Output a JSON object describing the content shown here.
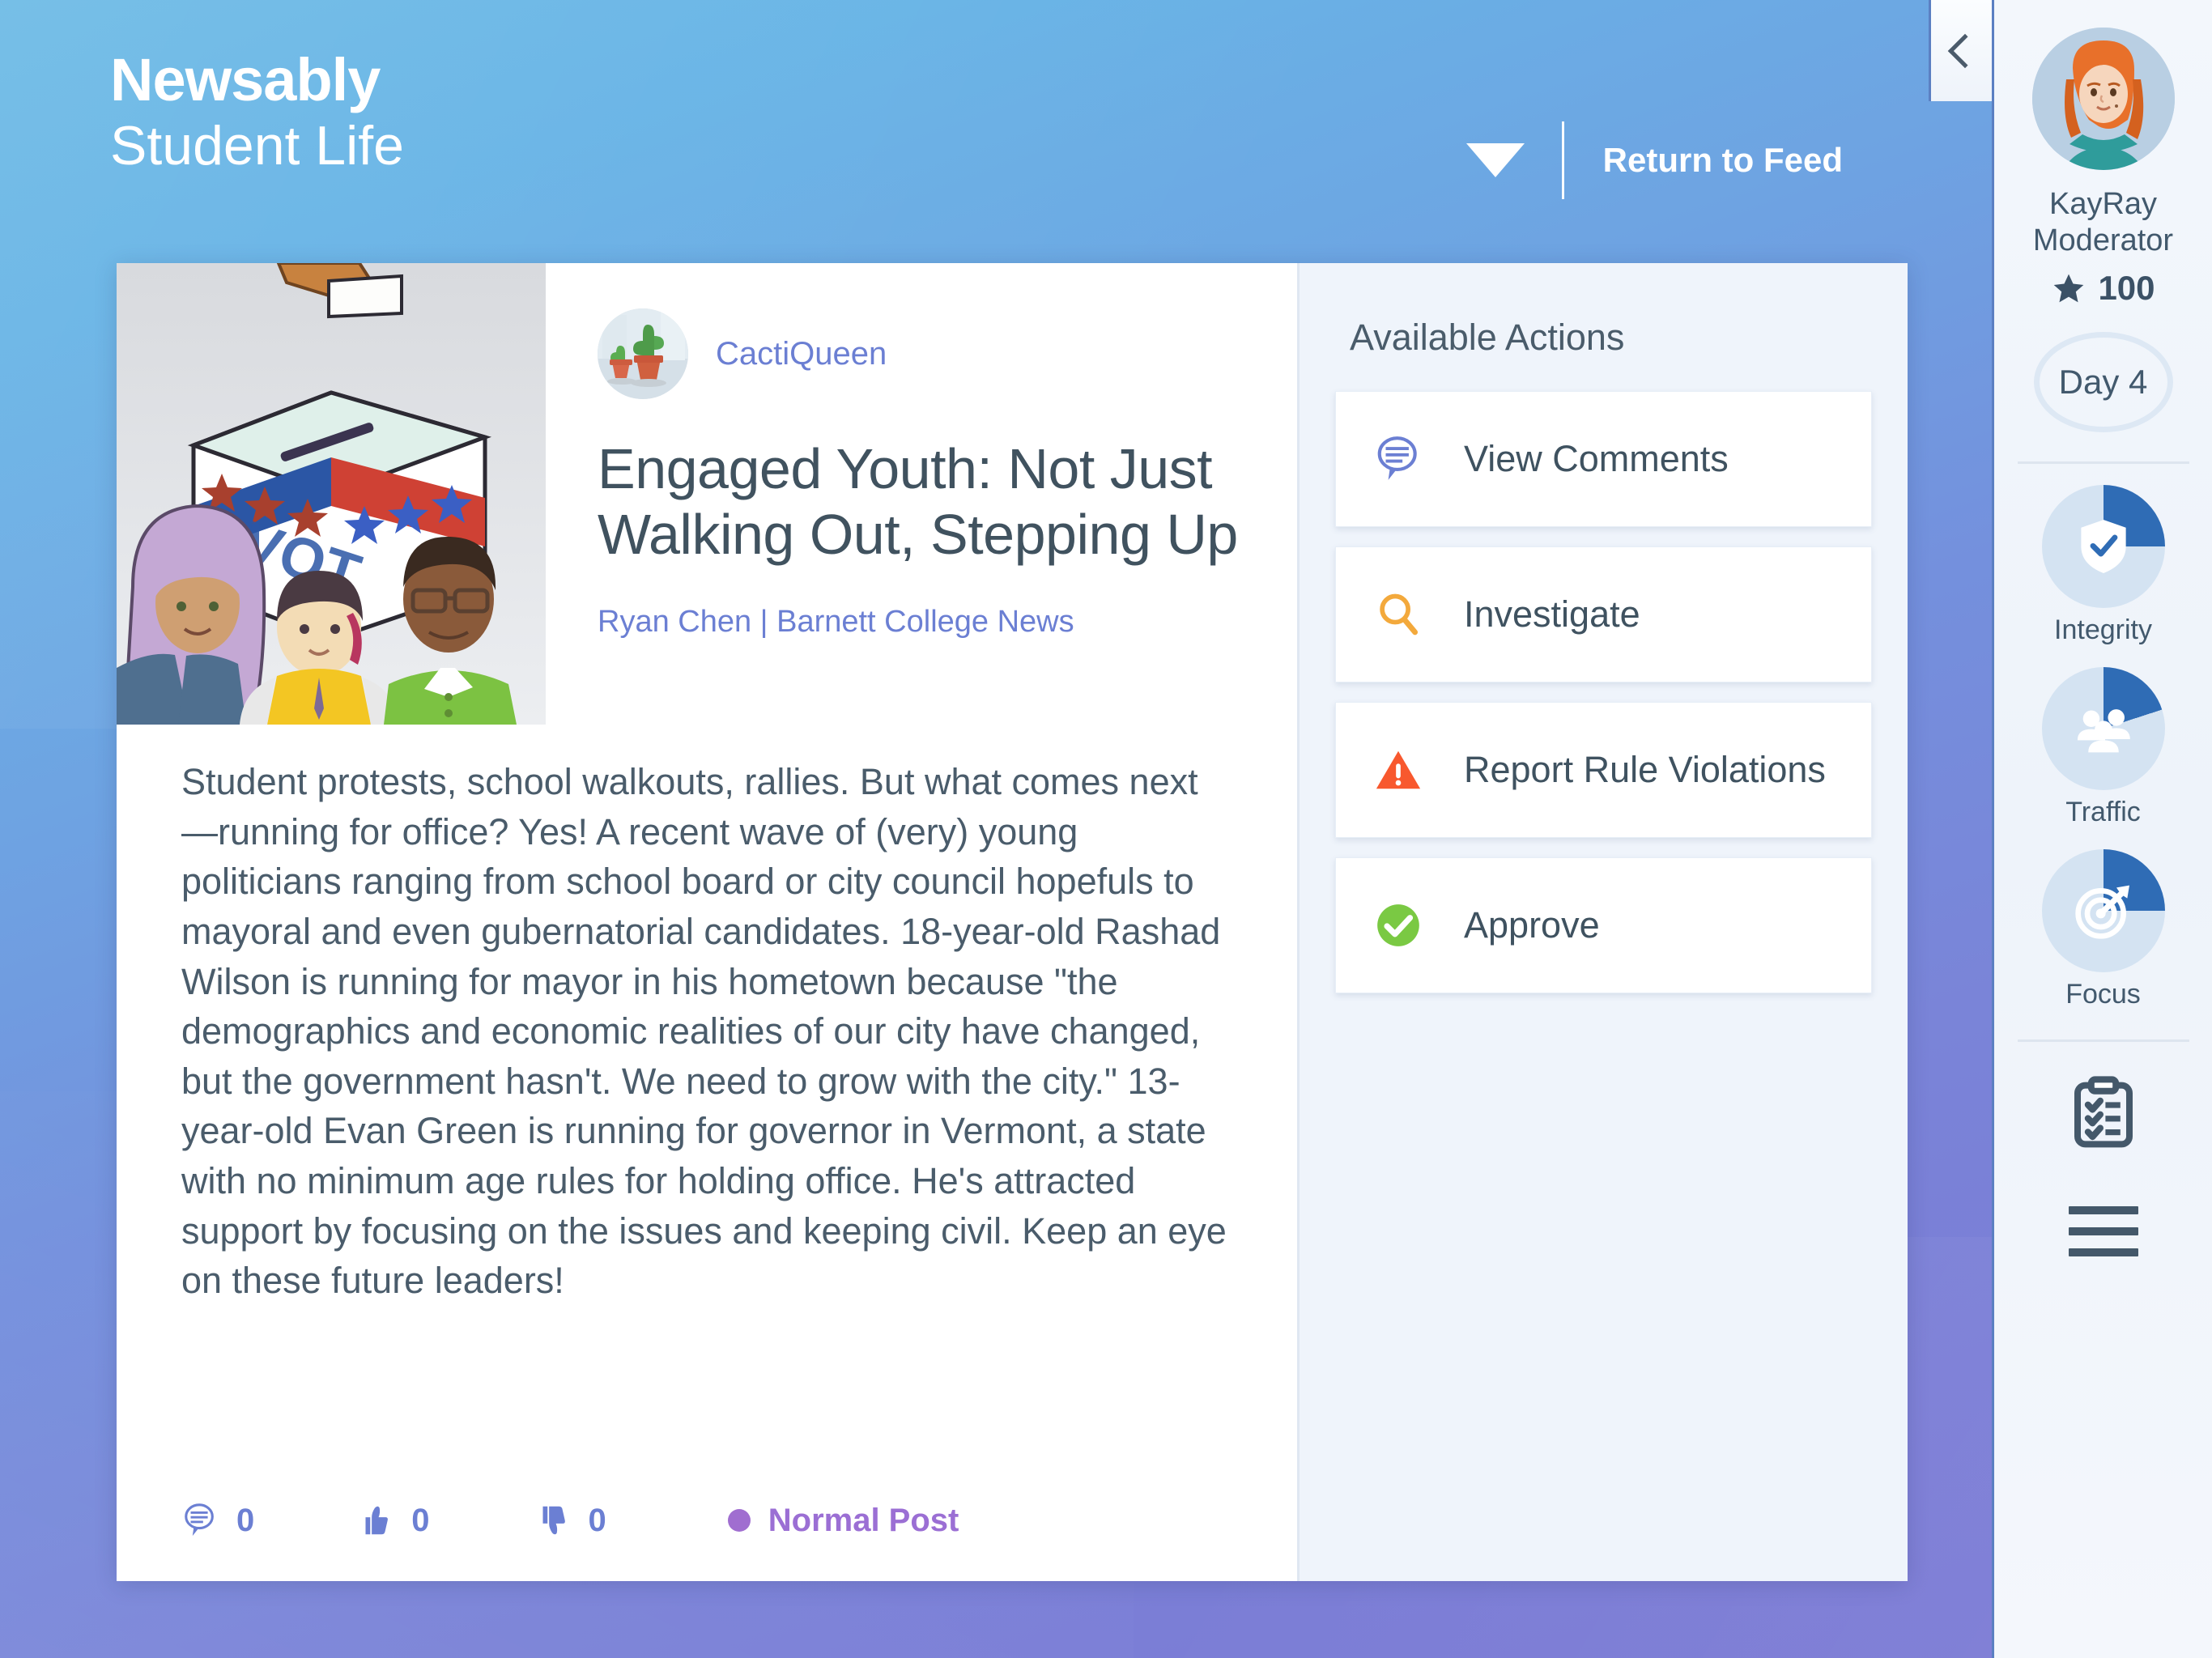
{
  "header": {
    "brand_title": "Newsably",
    "brand_subtitle": "Student Life",
    "return_label": "Return to Feed",
    "dropdown_icon": "caret-down-icon",
    "collapse_icon": "chevron-left-icon"
  },
  "article": {
    "author": "CactiQueen",
    "author_avatar_icon": "cacti-avatar",
    "thumbnail_icon": "vote-ballot-illustration",
    "title": "Engaged Youth: Not Just Walking Out, Stepping Up",
    "byline": "Ryan Chen | Barnett College News",
    "body": "Student protests, school walkouts, rallies. But what comes next—running for office? Yes! A recent wave of (very) young politicians ranging from school board or city council hopefuls to mayoral and even gubernatorial candidates. 18-year-old Rashad Wilson is running for mayor in his hometown because \"the demographics and economic realities of our city have changed, but the government hasn't. We need to grow with the city.\" 13-year-old Evan Green is running for governor in Vermont, a state with no minimum age rules for holding office. He's attracted support by focusing on the issues and keeping civil. Keep an eye on these future leaders!",
    "stats": {
      "comments": "0",
      "likes": "0",
      "dislikes": "0",
      "post_type": "Normal Post",
      "post_type_color": "#9b6fd4"
    }
  },
  "actions": {
    "title": "Available Actions",
    "items": [
      {
        "label": "View Comments",
        "icon": "comment-bubble-icon",
        "color": "#6b7fd3"
      },
      {
        "label": "Investigate",
        "icon": "magnifier-icon",
        "color": "#f3a93c"
      },
      {
        "label": "Report Rule Violations",
        "icon": "warning-triangle-icon",
        "color": "#f8582e"
      },
      {
        "label": "Approve",
        "icon": "check-circle-icon",
        "color": "#7ac943"
      }
    ]
  },
  "sidebar": {
    "avatar_icon": "user-avatar",
    "username": "KayRay",
    "role": "Moderator",
    "score_icon": "star-icon",
    "score": "100",
    "day_label": "Day 4",
    "meters": [
      {
        "label": "Integrity",
        "icon": "shield-check-icon",
        "percent": 25
      },
      {
        "label": "Traffic",
        "icon": "people-group-icon",
        "percent": 20
      },
      {
        "label": "Focus",
        "icon": "target-dart-icon",
        "percent": 25
      }
    ],
    "tasks_icon": "clipboard-checklist-icon",
    "menu_icon": "hamburger-menu-icon"
  },
  "theme": {
    "accent_blue": "#6b7fd3",
    "meter_fill": "#2f6cb5",
    "meter_track": "#d4e3f2"
  }
}
